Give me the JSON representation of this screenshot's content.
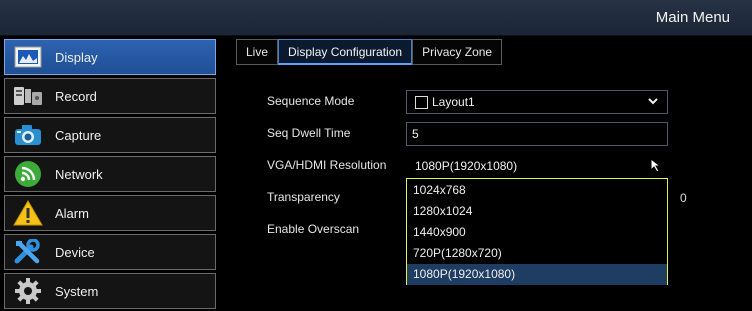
{
  "header": {
    "title": "Main Menu"
  },
  "sidebar": {
    "items": [
      {
        "label": "Display",
        "icon": "display-icon",
        "active": true
      },
      {
        "label": "Record",
        "icon": "record-icon"
      },
      {
        "label": "Capture",
        "icon": "camera-icon"
      },
      {
        "label": "Network",
        "icon": "network-icon"
      },
      {
        "label": "Alarm",
        "icon": "alarm-icon"
      },
      {
        "label": "Device",
        "icon": "device-icon"
      },
      {
        "label": "System",
        "icon": "gear-icon"
      }
    ]
  },
  "tabs": [
    {
      "label": "Live"
    },
    {
      "label": "Display Configuration",
      "active": true
    },
    {
      "label": "Privacy Zone"
    }
  ],
  "form": {
    "sequence_mode": {
      "label": "Sequence Mode",
      "value": "Layout1"
    },
    "seq_dwell_time": {
      "label": "Seq Dwell Time",
      "value": "5"
    },
    "resolution": {
      "label": "VGA/HDMI Resolution",
      "value": "1080P(1920x1080)"
    },
    "transparency": {
      "label": "Transparency",
      "value": "0"
    },
    "overscan": {
      "label": "Enable Overscan"
    }
  },
  "resolution_options": [
    "1024x768",
    "1280x1024",
    "1440x900",
    "720P(1280x720)",
    "1080P(1920x1080)"
  ],
  "colors": {
    "accent": "#2d63b0",
    "dropdown_border": "#e6f04a",
    "selected_option": "#1f3c62"
  }
}
